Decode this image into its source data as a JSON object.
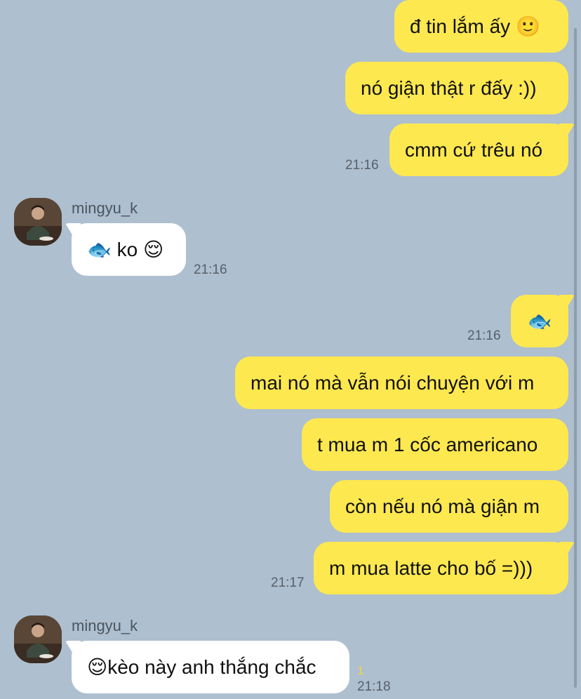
{
  "colors": {
    "background": "#aebfcf",
    "outgoing": "#fde84f",
    "incoming": "#ffffff",
    "unread": "#f3d53a"
  },
  "contact": {
    "username": "mingyu_k"
  },
  "messages": [
    {
      "dir": "out",
      "text": "đ tin lắm ấy 🙂"
    },
    {
      "dir": "out",
      "text": "nó giận thật r đấy :))"
    },
    {
      "dir": "out",
      "text": "cmm cứ trêu nó",
      "time": "21:16"
    },
    {
      "dir": "in",
      "sender": "mingyu_k",
      "text": "🐟 ko 😌",
      "time": "21:16"
    },
    {
      "dir": "out",
      "text": "🐟",
      "time": "21:16"
    },
    {
      "dir": "out",
      "text": "mai nó mà vẫn nói chuyện với m"
    },
    {
      "dir": "out",
      "text": "t mua m 1 cốc americano"
    },
    {
      "dir": "out",
      "text": "còn nếu nó mà giận m"
    },
    {
      "dir": "out",
      "text": "m mua latte cho bố =)))",
      "time": "21:17"
    },
    {
      "dir": "in",
      "sender": "mingyu_k",
      "text": "😌kèo này anh thắng chắc",
      "time": "21:18",
      "unread": "1"
    }
  ]
}
